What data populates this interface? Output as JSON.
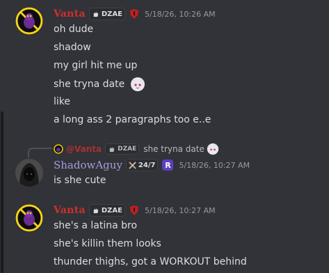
{
  "messages": [
    {
      "author": "Vanta",
      "tag": "DZAE",
      "timestamp": "5/18/26, 10:26 AM",
      "lines": [
        "oh dude",
        "shadow",
        "my girl hit me up",
        "she tryna date",
        "like",
        "a long ass 2 paragraphs too e..e"
      ]
    },
    {
      "reply": {
        "author": "@Vanta",
        "tag": "DZAE",
        "text": "she tryna date"
      },
      "author": "ShadowAguy",
      "tag": "24/7",
      "role_badge": "R",
      "timestamp": "5/18/26, 10:27 AM",
      "lines": [
        "is she cute"
      ]
    },
    {
      "author": "Vanta",
      "tag": "DZAE",
      "timestamp": "5/18/26, 10:27 AM",
      "lines": [
        "she's a latina bro",
        "she's killin them looks",
        "thunder thighs, got a WORKOUT behind"
      ]
    }
  ],
  "colors": {
    "background": "#313338",
    "vanta_name": "#d22f2f",
    "shadow_name": "#a99ad8",
    "text": "#dbdee1",
    "timestamp": "#949ba4"
  },
  "icons": {
    "vanta_avatar": "purple-creature-in-yellow-ring-avatar",
    "shadow_avatar": "hooded-figure-avatar",
    "role_icon": "red-shield-icon",
    "tag_icon": "hand-wave-icon",
    "swords_icon": "crossed-swords-icon",
    "emoji": "anime-girl-emoji"
  }
}
